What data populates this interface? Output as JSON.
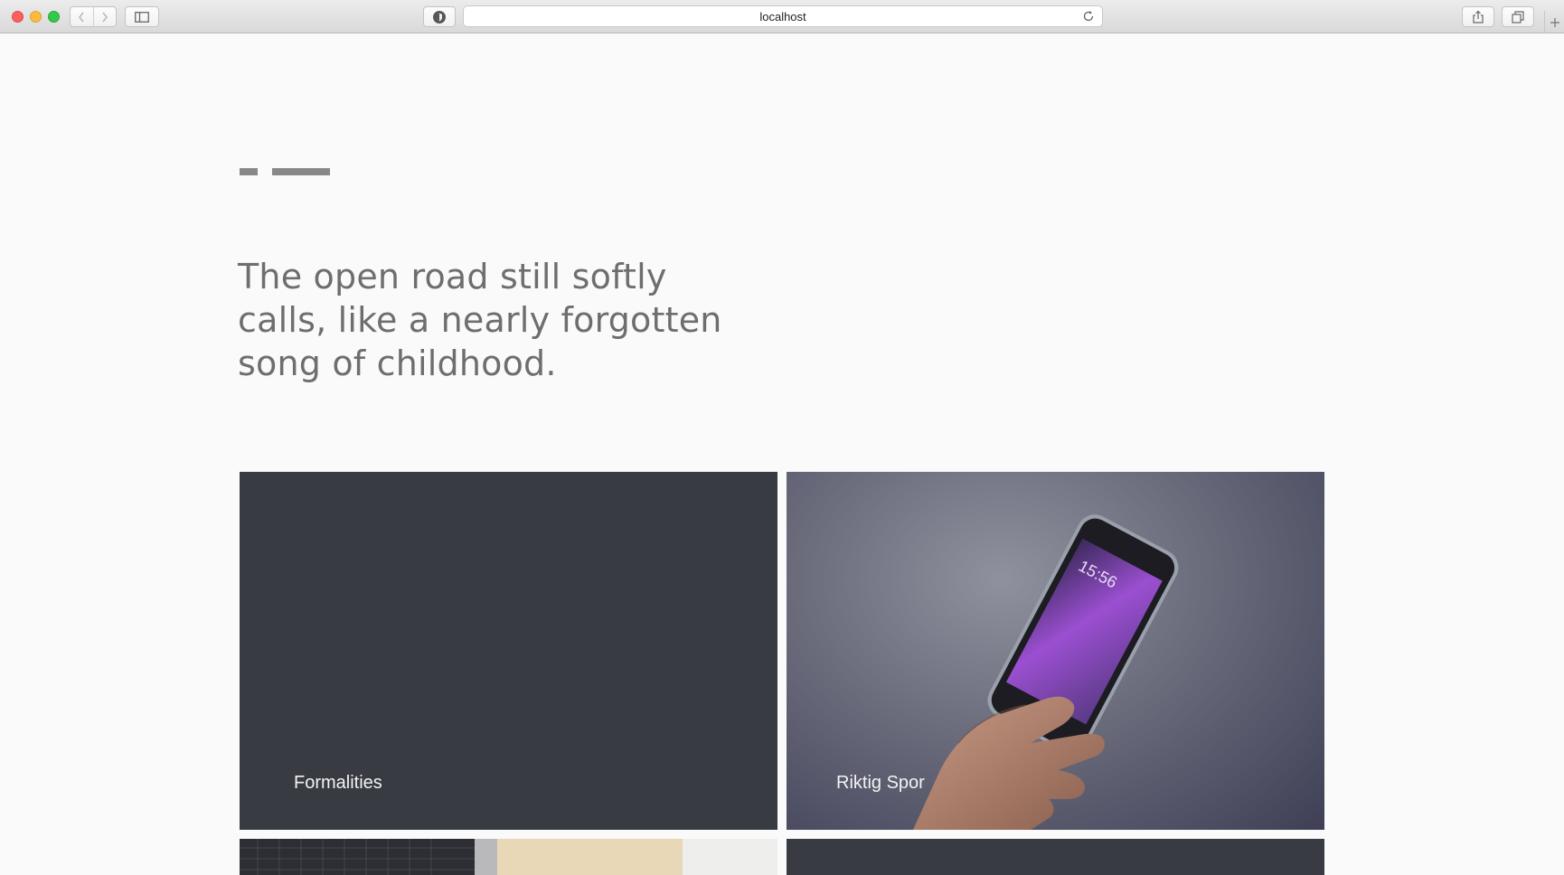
{
  "browser": {
    "url": "localhost"
  },
  "page": {
    "headline": "The open road still softly calls, like a nearly forgotten song of childhood."
  },
  "cards": [
    {
      "title": "Formalities",
      "kind": "solid",
      "color": "#393b43"
    },
    {
      "title": "Riktig Spor",
      "kind": "photo",
      "photo": "hand holding smartphone",
      "phone_time": "15:56"
    },
    {
      "title": "",
      "kind": "photo"
    },
    {
      "title": "",
      "kind": "solid",
      "color": "#393b43"
    }
  ]
}
